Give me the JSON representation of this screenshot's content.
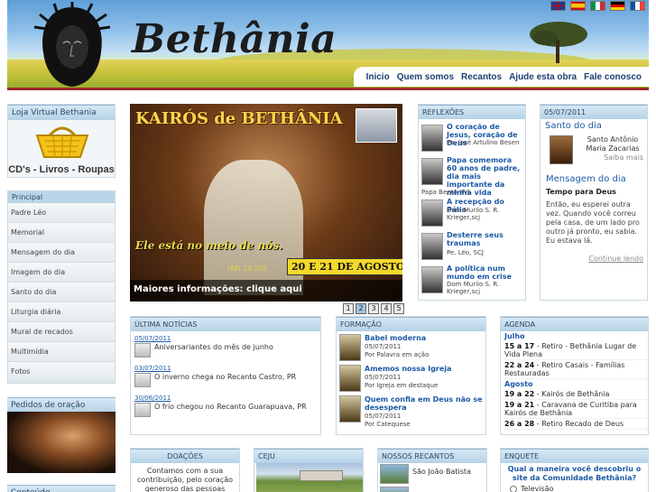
{
  "header": {
    "brand": "Bethânia",
    "languages": [
      "english",
      "español",
      "italiano",
      "deutsch",
      "français"
    ],
    "nav": [
      "Inicio",
      "Quem somos",
      "Recantos",
      "Ajude esta obra",
      "Fale conosco"
    ]
  },
  "loja": {
    "title": "Loja Virtual Bethania",
    "caption": "CD's - Livros - Roupas"
  },
  "menu": {
    "heading": "Principal",
    "items": [
      "Padre Léo",
      "Memorial",
      "Mensagem do dia",
      "Imagem do dia",
      "Santo do dia",
      "Liturgia diária",
      "Mural de recados",
      "Multimídia",
      "Fotos"
    ]
  },
  "pedidos": {
    "title": "Pedidos de oração"
  },
  "conteudo": {
    "title": "Conteúdo"
  },
  "slideshow": {
    "title": "KAIRÓS de BETHÂNIA",
    "motto": "Ele está no meio de nós.",
    "reference": "(Mt 18,20)",
    "dates": "20 E 21 DE AGOSTO",
    "caption": "Maiores informações: clique aqui",
    "pages": [
      "1",
      "2",
      "3",
      "4",
      "5"
    ],
    "active_page": "2"
  },
  "reflexoes": {
    "title": "REFLEXÕES",
    "items": [
      {
        "title": "O coração de Jesus, coração de Deus",
        "author": "Pe. José Artulino Besen"
      },
      {
        "title": "Papa comemora 60 anos de padre, dia mais importante da minha vida",
        "author": "Papa Bento XVI"
      },
      {
        "title": "A recepção do Pálio",
        "author": "Dom Murilo S. R. Krieger,scj"
      },
      {
        "title": "Desterre seus traumas",
        "author": "Pe. Léo, SCJ"
      },
      {
        "title": "A política num mundo em crise",
        "author": "Dom Murilo S. R. Krieger,scj"
      }
    ]
  },
  "santo": {
    "date": "05/07/2011",
    "heading": "Santo do dia",
    "name": "Santo Antônio Maria Zacarias",
    "more": "Saiba mais",
    "msg_heading": "Mensagem do dia",
    "msg_title": "Tempo para Deus",
    "msg_text": "Então, eu esperei outra vez. Quando você correu pela casa, de um lado pro outro já pronto, eu sabia. Eu estava lá.",
    "continue": "Continue lendo"
  },
  "noticias": {
    "title": "ÚLTIMA NOTÍCIAS",
    "items": [
      {
        "date": "05/07/2011",
        "text": "Aniversariantes do mês de junho"
      },
      {
        "date": "03/07/2011",
        "text": "O inverno chega no Recanto Castro, PR"
      },
      {
        "date": "30/06/2011",
        "text": "O frio chegou no Recanto Guarapuava, PR"
      }
    ]
  },
  "formacao": {
    "title": "FORMAÇÃO",
    "items": [
      {
        "title": "Babel moderna",
        "date": "05/07/2011",
        "author": "Por Palavra em ação"
      },
      {
        "title": "Amemos nossa Igreja",
        "date": "05/07/2011",
        "author": "Por Igreja em destaque"
      },
      {
        "title": "Quem confia em Deus não se desespera",
        "date": "05/07/2011",
        "author": "Por Catequese"
      }
    ]
  },
  "agenda": {
    "title": "AGENDA",
    "months": [
      {
        "name": "Julho",
        "events": [
          {
            "date": "15 a 17",
            "text": "Retiro - Bethânia Lugar de Vida Plena"
          },
          {
            "date": "22 a 24",
            "text": "Retiro Casais - Famílias Restauradas"
          }
        ]
      },
      {
        "name": "Agosto",
        "events": [
          {
            "date": "19 a 22",
            "text": "Kairós de Bethânia"
          },
          {
            "date": "19 a 21",
            "text": "Caravana de Curitiba para Kairós de Bethânia"
          },
          {
            "date": "26 a 28",
            "text": "Retiro Recado de Deus"
          }
        ]
      }
    ]
  },
  "doacoes": {
    "title": "DOAÇÕES",
    "text": "Contamos com a sua contribuição, pelo coração generoso das pessoas"
  },
  "ceju": {
    "title": "CEJU"
  },
  "recantos": {
    "title": "NOSSOS RECANTOS",
    "items": [
      "São João Batista"
    ]
  },
  "enquete": {
    "title": "ENQUETE",
    "question": "Qual a maneira você descobriu o site da Comunidade Bethânia?",
    "options": [
      "Televisão"
    ]
  }
}
